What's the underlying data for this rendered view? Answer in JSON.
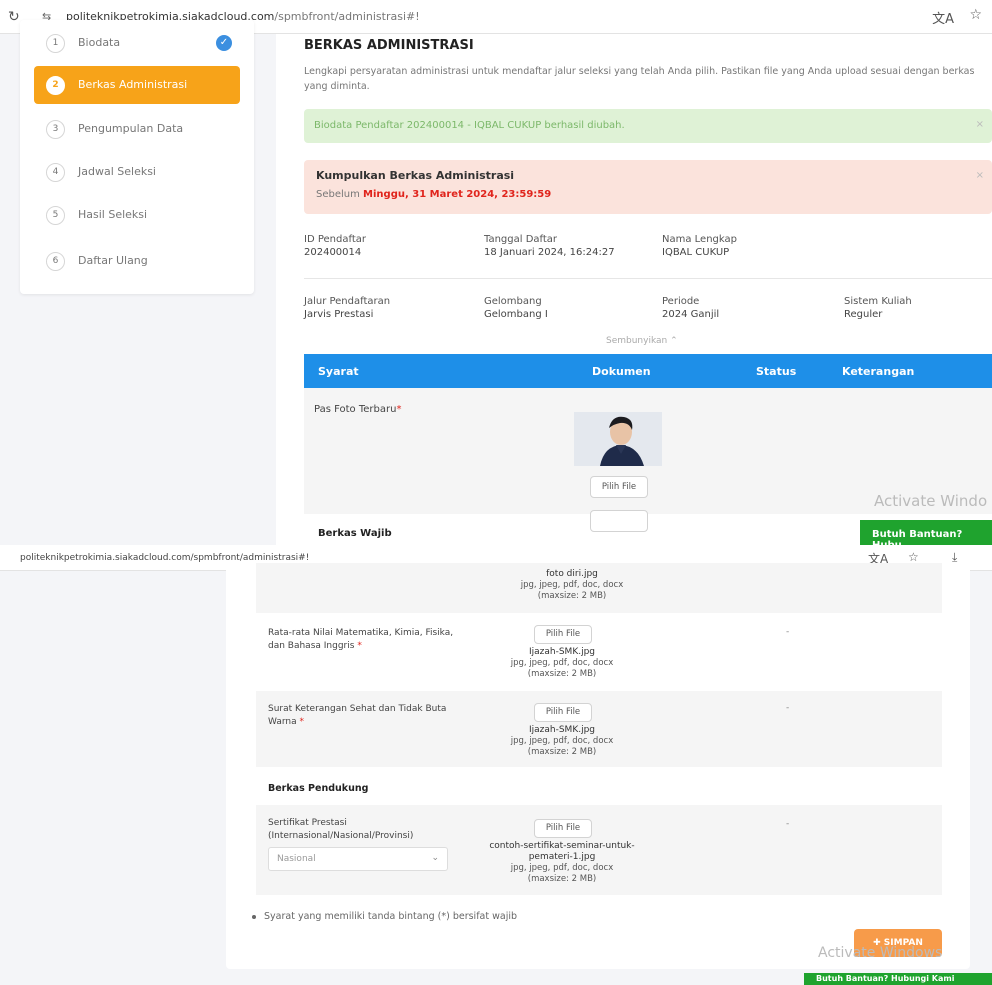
{
  "browser1": {
    "reload_icon": "↻",
    "site_icon": "⇆",
    "url_host": "politeknikpetrokimia.siakadcloud.com",
    "url_path": "/spmbfront/administrasi#!",
    "translate_icon": "文A",
    "star_icon": "☆"
  },
  "sidebar": {
    "items": [
      {
        "num": "1",
        "label": "Biodata",
        "check": "✓"
      },
      {
        "num": "2",
        "label": "Berkas Administrasi"
      },
      {
        "num": "3",
        "label": "Pengumpulan Data"
      },
      {
        "num": "4",
        "label": "Jadwal Seleksi"
      },
      {
        "num": "5",
        "label": "Hasil Seleksi"
      },
      {
        "num": "6",
        "label": "Daftar Ulang"
      }
    ]
  },
  "main": {
    "title": "BERKAS ADMINISTRASI",
    "description": "Lengkapi persyaratan administrasi untuk mendaftar jalur seleksi yang telah Anda pilih. Pastikan file yang Anda upload sesuai dengan berkas yang diminta.",
    "alert_success": "Biodata Pendaftar 202400014 - IQBAL CUKUP berhasil diubah.",
    "alert_close": "×",
    "deadline_title": "Kumpulkan Berkas Administrasi",
    "deadline_prefix": "Sebelum",
    "deadline_date": "Minggu, 31 Maret 2024, 23:59:59",
    "info_row1": [
      {
        "label": "ID Pendaftar",
        "value": "202400014"
      },
      {
        "label": "Tanggal Daftar",
        "value": "18 Januari 2024, 16:24:27"
      },
      {
        "label": "Nama Lengkap",
        "value": "IQBAL CUKUP"
      }
    ],
    "info_row2": [
      {
        "label": "Jalur Pendaftaran",
        "value": "Jarvis Prestasi"
      },
      {
        "label": "Gelombang",
        "value": "Gelombang I"
      },
      {
        "label": "Periode",
        "value": "2024 Ganjil"
      },
      {
        "label": "Sistem Kuliah",
        "value": "Reguler"
      }
    ],
    "hide_toggle": "Sembunyikan ⌃",
    "table_headers": [
      "Syarat",
      "Dokumen",
      "Status",
      "Keterangan"
    ],
    "pas_foto_label": "Pas Foto Terbaru",
    "required_mark": "*",
    "pilih_file": "Pilih File",
    "berkas_wajib": "Berkas Wajib",
    "activate_windows": "Activate Windo",
    "help_button": "Butuh Bantuan? Hubu"
  },
  "browser2": {
    "url": "politeknikpetrokimia.siakadcloud.com/spmbfront/administrasi#!",
    "translate_icon": "文A",
    "star_icon": "☆",
    "download_icon": "⤓"
  },
  "lower": {
    "top_partial": {
      "filename": "foto diri.jpg",
      "types": "jpg, jpeg, pdf, doc, docx",
      "maxsize": "(maxsize: 2 MB)"
    },
    "rows": [
      {
        "label": "Rata-rata Nilai Matematika, Kimia, Fisika, dan Bahasa Inggris",
        "button": "Pilih File",
        "filename": "Ijazah-SMK.jpg",
        "types": "jpg, jpeg, pdf, doc, docx",
        "maxsize": "(maxsize: 2 MB)",
        "status": "-"
      },
      {
        "label": "Surat Keterangan Sehat dan Tidak Buta Warna",
        "button": "Pilih File",
        "filename": "Ijazah-SMK.jpg",
        "types": "jpg, jpeg, pdf, doc, docx",
        "maxsize": "(maxsize: 2 MB)",
        "status": "-"
      }
    ],
    "berkas_pendukung": "Berkas Pendukung",
    "sertifikat": {
      "label": "Sertifikat Prestasi (Internasional/Nasional/Provinsi)",
      "select_value": "Nasional",
      "button": "Pilih File",
      "filename": "contoh-sertifikat-seminar-untuk-pemateri-1.jpg",
      "types": "jpg, jpeg, pdf, doc, docx",
      "maxsize": "(maxsize: 2 MB)",
      "status": "-"
    },
    "note": "Syarat yang memiliki tanda bintang (*) bersifat wajib",
    "simpan": "✚ SIMPAN",
    "activate_windows": "Activate Windows",
    "help_button": "Butuh Bantuan? Hubungi Kami"
  },
  "colors": {
    "accent": "#f7a319",
    "table_header": "#1e8fe8",
    "success_bg": "#dff2d6",
    "danger_bg": "#fbe3dc",
    "deadline": "#e0241c",
    "help": "#1fa32e",
    "save": "#f79b4a"
  }
}
